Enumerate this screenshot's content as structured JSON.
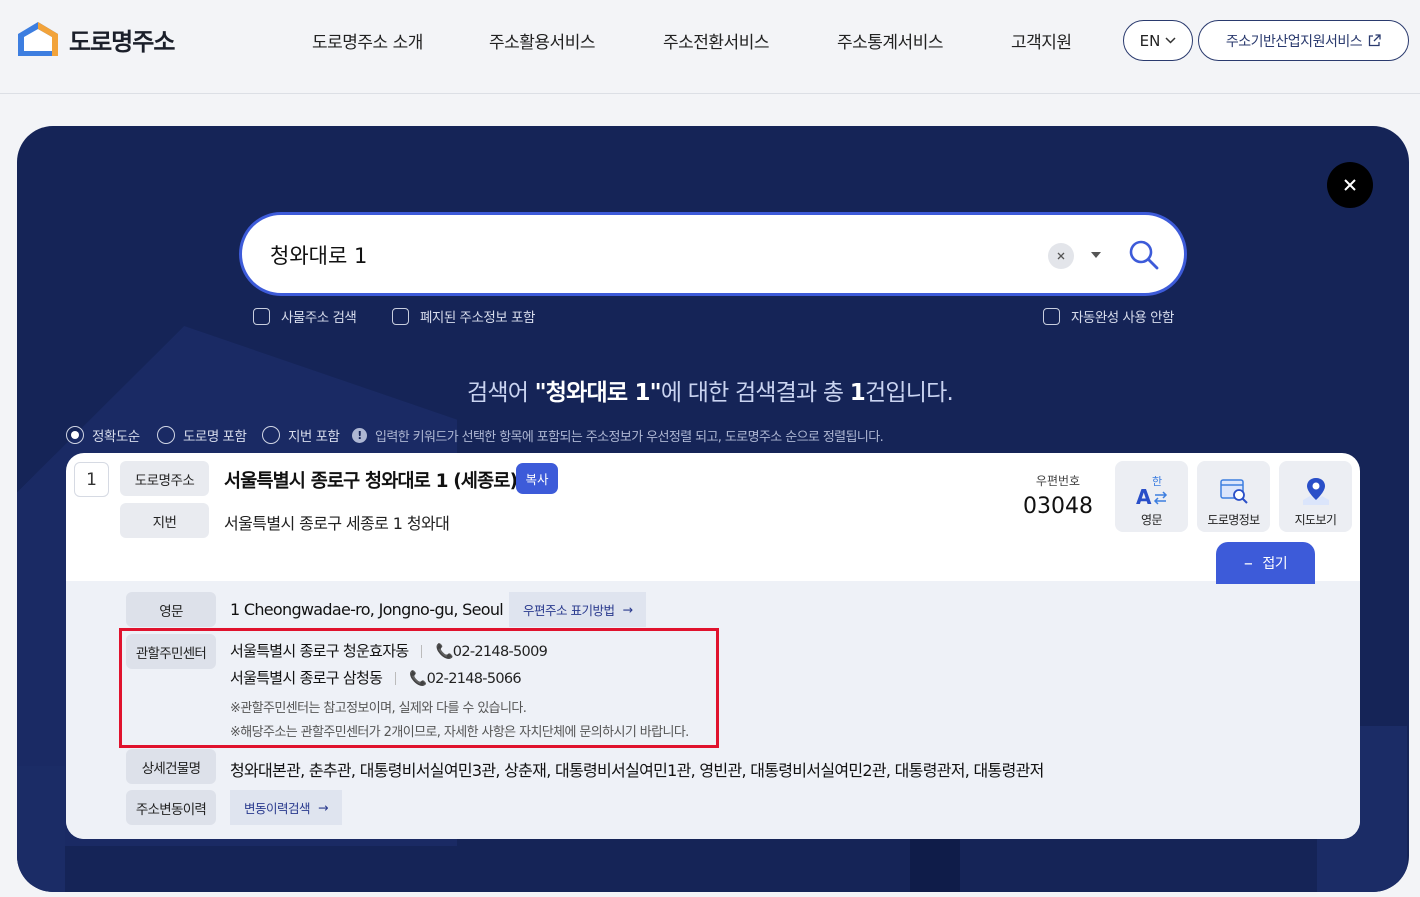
{
  "header": {
    "logo_text": "도로명주소",
    "nav": [
      "도로명주소 소개",
      "주소활용서비스",
      "주소전환서비스",
      "주소통계서비스",
      "고객지원"
    ],
    "lang_label": "EN",
    "biz_label": "주소기반산업지원서비스"
  },
  "search": {
    "query": "청와대로 1",
    "options": [
      "사물주소 검색",
      "폐지된 주소정보 포함",
      "자동완성 사용 안함"
    ]
  },
  "summary": {
    "prefix": "검색어 ",
    "keyword": "\"청와대로 1\"",
    "middle": "에 대한 검색결과 총 ",
    "count": "1",
    "suffix": "건입니다."
  },
  "sort": {
    "options": [
      "정확도순",
      "도로명 포함",
      "지번 포함"
    ],
    "selected": "정확도순",
    "notice": "입력한 키워드가 선택한 항목에 포함되는 주소정보가 우선정렬 되고, 도로명주소 순으로 정렬됩니다."
  },
  "result": {
    "index": "1",
    "road_tag": "도로명주소",
    "road_address": "서울특별시 종로구 청와대로 1 (세종로)",
    "copy_label": "복사",
    "jibun_tag": "지번",
    "jibun_address": "서울특별시 종로구 세종로 1 청와대",
    "zip_label": "우편번호",
    "zip_code": "03048",
    "actions": [
      "영문",
      "도로명정보",
      "지도보기"
    ],
    "fold_label": "접기",
    "details": {
      "english_tag": "영문",
      "english_address": "1 Cheongwadae-ro, Jongno-gu, Seoul",
      "english_link": "우편주소 표기방법",
      "center_tag": "관할주민센터",
      "centers": [
        {
          "name": "서울특별시 종로구 청운효자동",
          "phone": "02-2148-5009"
        },
        {
          "name": "서울특별시 종로구 삼청동",
          "phone": "02-2148-5066"
        }
      ],
      "center_notes": [
        "※관할주민센터는 참고정보이며, 실제와 다를 수 있습니다.",
        "※해당주소는 관할주민센터가 2개이므로, 자세한 사항은 자치단체에 문의하시기 바랍니다."
      ],
      "building_tag": "상세건물명",
      "building_names": "청와대본관, 춘추관, 대통령비서실여민3관, 상춘재, 대통령비서실여민1관, 영빈관, 대통령비서실여민2관, 대통령관저, 대통령관저",
      "history_tag": "주소변동이력",
      "history_link": "변동이력검색"
    }
  },
  "colors": {
    "panel": "#152457",
    "accent": "#3d5bd9",
    "highlight": "#e0122d"
  }
}
